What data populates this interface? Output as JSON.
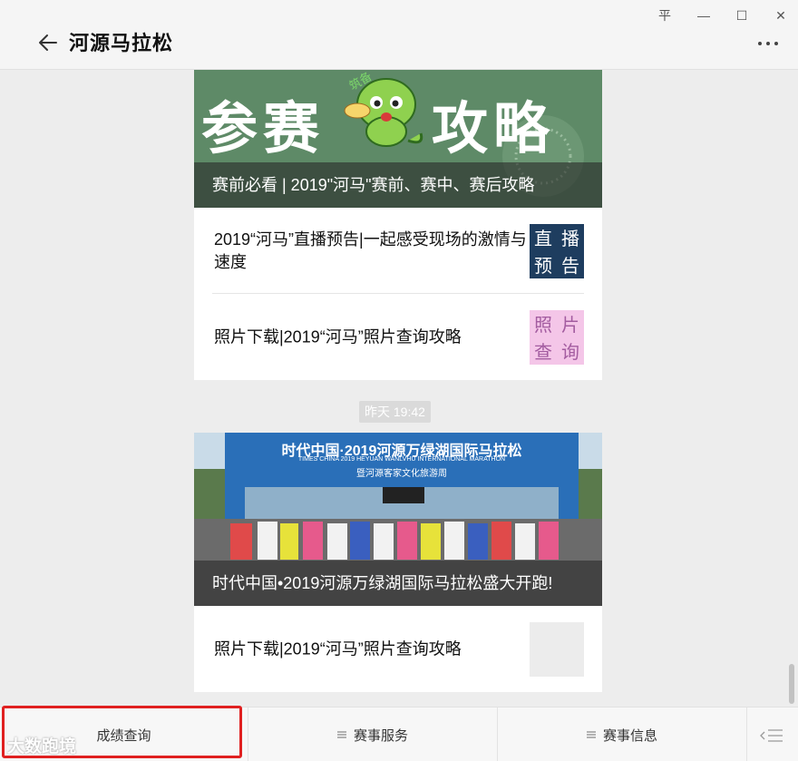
{
  "window": {
    "title": "河源马拉松",
    "pin_label": "平",
    "minimize_label": "—",
    "maximize_label": "☐",
    "close_label": "✕"
  },
  "feed": {
    "group1": {
      "cover_art_text": "参赛攻略",
      "cover_stamp_text": "筑备",
      "cover_title": "赛前必看 | 2019\"河马\"赛前、赛中、赛后攻略",
      "articles": [
        {
          "title": "2019“河马”直播预告|一起感受现场的激情与速度",
          "thumb_text": [
            "直",
            "播",
            "预",
            "告"
          ],
          "thumb_bg": "#1e3d5f"
        },
        {
          "title": "照片下载|2019“河马”照片查询攻略",
          "thumb_text": [
            "照",
            "片",
            "查",
            "询"
          ],
          "thumb_bg": "#f4c6e8"
        }
      ]
    },
    "timestamp": "昨天 19:42",
    "group2": {
      "banner_line1": "时代中国·2019河源万绿湖国际马拉松",
      "banner_line2": "TIMES CHINA 2019 HEYUAN WANLVHU INTERNATIONAL MARATHON",
      "banner_line3": "暨河源客家文化旅游周",
      "cover_title": "时代中国•2019河源万绿湖国际马拉松盛大开跑!",
      "articles": [
        {
          "title": "照片下载|2019“河马”照片查询攻略"
        }
      ]
    }
  },
  "menu": {
    "items": [
      {
        "label": "成绩查询"
      },
      {
        "label": "赛事服务"
      },
      {
        "label": "赛事信息"
      }
    ],
    "watermark": "大数跑境"
  },
  "colors": {
    "accent_green": "#5e8a67",
    "highlight_red": "#e02020",
    "banner_blue": "#2a6fb8"
  }
}
